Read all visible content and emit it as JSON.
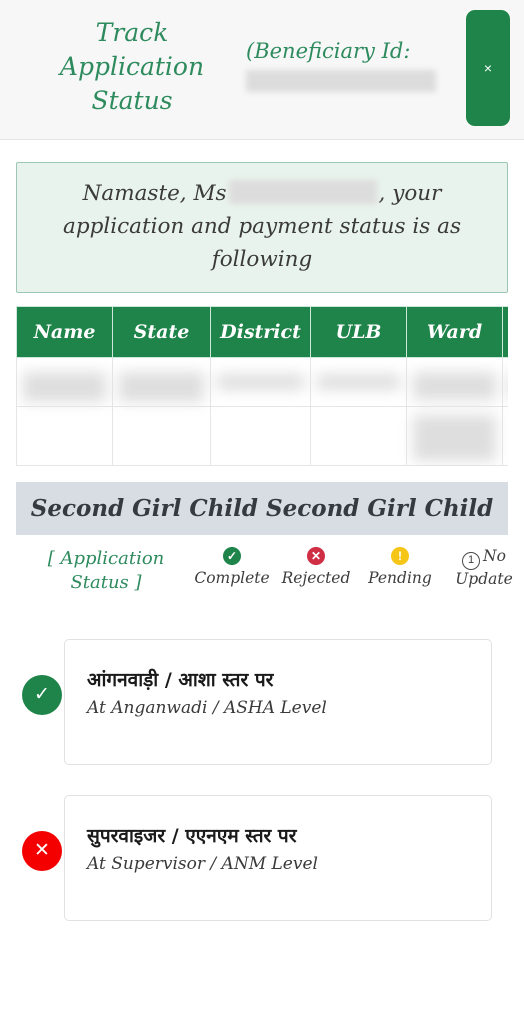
{
  "header": {
    "title_lines": [
      "Track",
      "Application",
      "Status"
    ],
    "beneficiary_label": "(Beneficiary Id:",
    "beneficiary_value_redacted": true,
    "close_label": "×",
    "accent_color": "#1e8449",
    "title_color": "#2e8b5e"
  },
  "greeting": {
    "prefix": "Namaste, Ms",
    "name_redacted": true,
    "suffix": ", your application and payment status is as following",
    "background": "#e9f3ed",
    "border_color": "#9cc7b4"
  },
  "table": {
    "columns": [
      "Name",
      "State",
      "District",
      "ULB",
      "Ward"
    ],
    "header_bg": "#1e8449",
    "rows": [
      {
        "cells": [
          "",
          "",
          "",
          "",
          ""
        ],
        "redacted": true
      },
      {
        "cells": [
          "",
          "",
          "",
          "",
          ""
        ],
        "redacted": true
      }
    ]
  },
  "section": {
    "title": "Second Girl Child Second Girl Child",
    "background": "#d7dde2"
  },
  "legend": {
    "label_lines": [
      "[ Application",
      "Status ]"
    ],
    "items": [
      {
        "icon": "check-circle-icon",
        "glyph": "✓",
        "label": "Complete",
        "color": "#1e8449"
      },
      {
        "icon": "x-circle-icon",
        "glyph": "✕",
        "label": "Rejected",
        "color": "#cf2e44"
      },
      {
        "icon": "exclamation-circle-icon",
        "glyph": "!",
        "label": "Pending",
        "color": "#f5c518"
      },
      {
        "icon": "number-one-circle-icon",
        "glyph": "1",
        "label": "No Update",
        "label_line1": "No",
        "label_line2": "Update",
        "color": "#4a4a4a"
      }
    ]
  },
  "steps": [
    {
      "status": "complete",
      "icon": "check-icon",
      "glyph": "✓",
      "color": "#1e8449",
      "title_hi": "आंगनवाड़ी / आशा स्तर पर",
      "title_en": "At Anganwadi / ASHA Level"
    },
    {
      "status": "rejected",
      "icon": "x-icon",
      "glyph": "✕",
      "color": "#f40000",
      "title_hi": "सुपरवाइजर / एएनएम स्तर पर",
      "title_en": "At Supervisor / ANM Level"
    }
  ]
}
